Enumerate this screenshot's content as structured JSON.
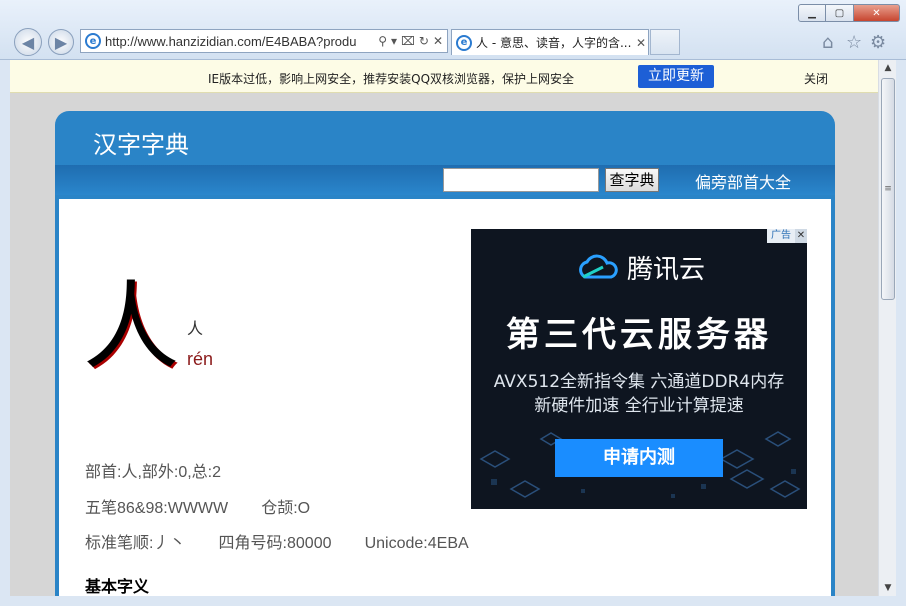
{
  "browser": {
    "url": "http://www.hanzizidian.com/E4BABA?produ",
    "tab_title": "人 - 意思、读音，人字的含...",
    "win_min": "0",
    "win_max": "□",
    "win_close": "✕"
  },
  "infobar": {
    "message": "IE版本过低，影响上网安全，推荐安装QQ双核浏览器，保护上网安全",
    "update_button": "立即更新",
    "close_label": "关闭"
  },
  "site": {
    "title": "汉字字典",
    "search_button": "查字典",
    "radical_link": "偏旁部首大全",
    "search_value": ""
  },
  "entry": {
    "character": "人",
    "character_small": "人",
    "pinyin": "rén",
    "radical_line": "部首:人,部外:0,总:2",
    "wubi": "五笔86&98:WWWW",
    "cangjie": "仓颉:O",
    "stroke_order": "标准笔顺:丿丶",
    "four_corner": "四角号码:80000",
    "unicode": "Unicode:4EBA",
    "basic_meaning_title": "基本字义"
  },
  "ad": {
    "tag": "广告",
    "brand": "腾讯云",
    "headline": "第三代云服务器",
    "line1": "AVX512全新指令集 六通道DDR4内存",
    "line2": "新硬件加速 全行业计算提速",
    "cta": "申请内测"
  }
}
